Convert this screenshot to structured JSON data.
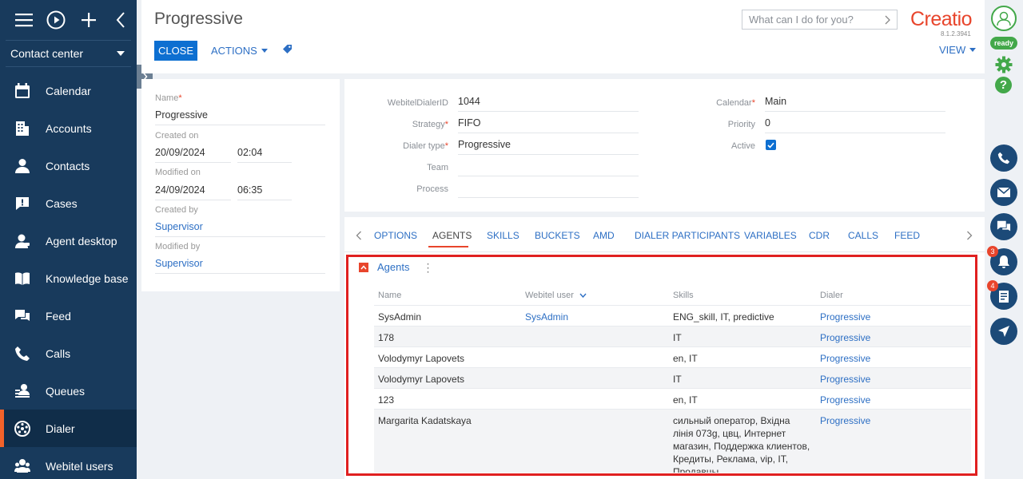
{
  "sidebar": {
    "section": "Contact center",
    "items": [
      {
        "label": "Calendar",
        "icon": "calendar-icon"
      },
      {
        "label": "Accounts",
        "icon": "building-icon"
      },
      {
        "label": "Contacts",
        "icon": "person-icon"
      },
      {
        "label": "Cases",
        "icon": "case-icon"
      },
      {
        "label": "Agent desktop",
        "icon": "agent-icon"
      },
      {
        "label": "Knowledge base",
        "icon": "book-icon"
      },
      {
        "label": "Feed",
        "icon": "chat-icon"
      },
      {
        "label": "Calls",
        "icon": "phone-icon"
      },
      {
        "label": "Queues",
        "icon": "queue-icon"
      },
      {
        "label": "Dialer",
        "icon": "dialer-icon",
        "active": true
      },
      {
        "label": "Webitel users",
        "icon": "users-icon"
      }
    ]
  },
  "header": {
    "title": "Progressive",
    "close_label": "CLOSE",
    "actions_label": "ACTIONS",
    "view_label": "VIEW",
    "search_placeholder": "What can I do for you?",
    "logo": "Creatio",
    "version": "8.1.2.3941"
  },
  "left_card": {
    "name_label": "Name",
    "name_value": "Progressive",
    "created_on_label": "Created on",
    "created_date": "20/09/2024",
    "created_time": "02:04",
    "modified_on_label": "Modified on",
    "modified_date": "24/09/2024",
    "modified_time": "06:35",
    "created_by_label": "Created by",
    "created_by_value": "Supervisor",
    "modified_by_label": "Modified by",
    "modified_by_value": "Supervisor"
  },
  "details": {
    "dialer_id_label": "WebitelDialerID",
    "dialer_id_value": "1044",
    "strategy_label": "Strategy",
    "strategy_value": "FIFO",
    "dialer_type_label": "Dialer type",
    "dialer_type_value": "Progressive",
    "team_label": "Team",
    "team_value": "",
    "process_label": "Process",
    "process_value": "",
    "calendar_label": "Calendar",
    "calendar_value": "Main",
    "priority_label": "Priority",
    "priority_value": "0",
    "active_label": "Active",
    "active_checked": true
  },
  "tabs": [
    "OPTIONS",
    "AGENTS",
    "SKILLS",
    "BUCKETS",
    "AMD",
    "DIALER PARTICIPANTS",
    "VARIABLES",
    "CDR",
    "CALLS",
    "FEED"
  ],
  "active_tab": "AGENTS",
  "agents": {
    "title": "Agents",
    "columns": [
      "Name",
      "Webitel user",
      "Skills",
      "Dialer"
    ],
    "rows": [
      {
        "name": "SysAdmin",
        "webitel_user": "SysAdmin",
        "skills": "ENG_skill, IT, predictive",
        "dialer": "Progressive"
      },
      {
        "name": "178",
        "webitel_user": "",
        "skills": "IT",
        "dialer": "Progressive"
      },
      {
        "name": "Volodymyr Lapovets",
        "webitel_user": "",
        "skills": "en, IT",
        "dialer": "Progressive"
      },
      {
        "name": "Volodymyr Lapovets",
        "webitel_user": "",
        "skills": "IT",
        "dialer": "Progressive"
      },
      {
        "name": "123",
        "webitel_user": "",
        "skills": "en, IT",
        "dialer": "Progressive"
      },
      {
        "name": "Margarita Kadatskaya",
        "webitel_user": "",
        "skills": "сильный оператор, Вхідна лінія 073g, цвц, Интернет магазин, Поддержка клиентов, Кредиты, Реклама, vip, IT, Продавцы",
        "dialer": "Progressive"
      }
    ]
  },
  "right_panel": {
    "status": "ready",
    "notifications_count": "3",
    "tasks_count": "4"
  },
  "colors": {
    "sidebar": "#183a5c",
    "accent": "#e8452c",
    "primary": "#0d6fd1",
    "link": "#2d6fc4",
    "highlight_box": "#e02020"
  }
}
